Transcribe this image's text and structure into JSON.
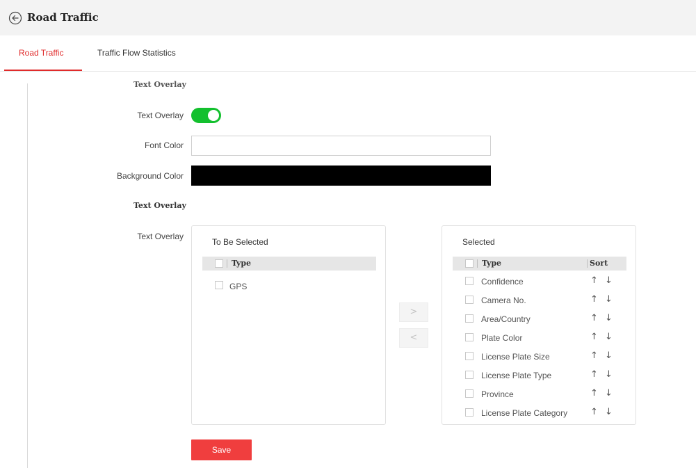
{
  "header": {
    "title": "Road Traffic",
    "back_icon": "circle-arrow-left-icon"
  },
  "tabs": [
    {
      "label": "Road Traffic",
      "active": true
    },
    {
      "label": "Traffic Flow Statistics",
      "active": false
    }
  ],
  "form": {
    "cut_heading": "Text Overlay",
    "text_overlay_label": "Text Overlay",
    "text_overlay_enabled": true,
    "font_color_label": "Font Color",
    "font_color_value": "#ffffff",
    "background_color_label": "Background Color",
    "background_color_value": "#000000",
    "section_title": "Text Overlay",
    "overlay_items_label": "Text Overlay"
  },
  "to_be_selected": {
    "title": "To Be Selected",
    "col_type": "Type",
    "items": [
      "GPS"
    ]
  },
  "selected": {
    "title": "Selected",
    "col_type": "Type",
    "col_sort": "Sort",
    "items": [
      "Confidence",
      "Camera No.",
      "Area/Country",
      "Plate Color",
      "License Plate Size",
      "License Plate Type",
      "Province",
      "License Plate Category"
    ]
  },
  "transfer": {
    "move_right": ">",
    "move_left": "<"
  },
  "sort_icons": {
    "up": "↑",
    "down": "↓"
  },
  "save_label": "Save",
  "colors": {
    "accent": "#e02b2b",
    "save_button": "#f03e3e",
    "switch_on": "#13c02e"
  }
}
